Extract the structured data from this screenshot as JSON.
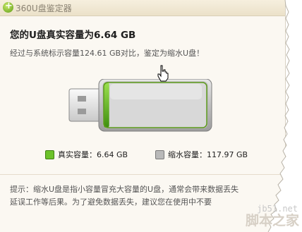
{
  "window": {
    "title": "360U盘鉴定器"
  },
  "result": {
    "headline": "您的U盘真实容量为6.64 GB",
    "detail": "经过与系统标示容量124.61 GB对比，鉴定为缩水U盘！"
  },
  "legend": {
    "real_label": "真实容量：6.64 GB",
    "shrink_label": "缩水容量：117.97 GB"
  },
  "tip": {
    "line1": "提示：缩水U盘是指小容量冒充大容量的U盘，通常会带来数据丢失",
    "line2": "延误工作等后果。为了避免数据丢失，建议您在使用中不要"
  },
  "watermark": {
    "site": "jb51.net",
    "name": "脚本之家"
  },
  "colors": {
    "real": "#6cc22a",
    "shrink": "#b9b9b9"
  },
  "icons": {
    "app": "360-plus-icon",
    "cursor": "hand-pointer-icon",
    "drive": "usb-drive-icon"
  },
  "usage": {
    "real_fraction": 0.053
  }
}
